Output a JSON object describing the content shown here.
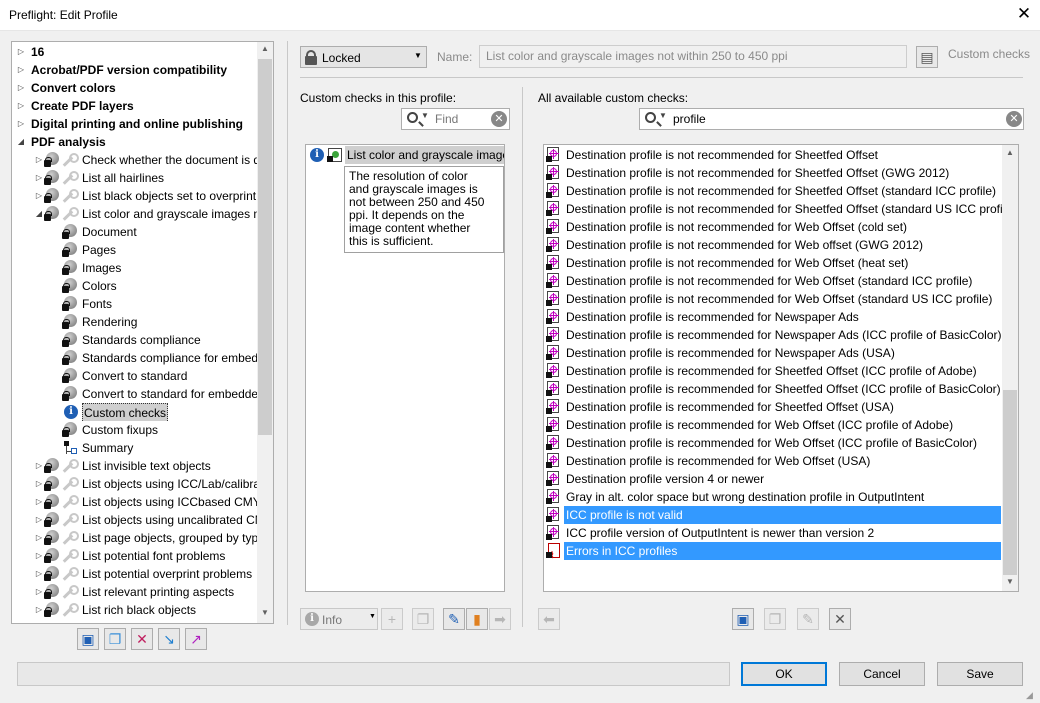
{
  "window": {
    "title": "Preflight: Edit Profile",
    "close_glyph": "✕"
  },
  "tree": {
    "items": [
      {
        "label": "16",
        "bold": true,
        "indent": 0,
        "arrow": "▷",
        "icon": "none"
      },
      {
        "label": "Acrobat/PDF version compatibility",
        "bold": true,
        "indent": 0,
        "arrow": "▷",
        "icon": "none"
      },
      {
        "label": "Convert colors",
        "bold": true,
        "indent": 0,
        "arrow": "▷",
        "icon": "none"
      },
      {
        "label": "Create PDF layers",
        "bold": true,
        "indent": 0,
        "arrow": "▷",
        "icon": "none"
      },
      {
        "label": "Digital printing and online publishing",
        "bold": true,
        "indent": 0,
        "arrow": "▷",
        "icon": "none"
      },
      {
        "label": "PDF analysis",
        "bold": true,
        "indent": 0,
        "arrow": "◢",
        "icon": "none"
      },
      {
        "label": "Check whether the document is d",
        "bold": false,
        "indent": 1,
        "arrow": "▷",
        "icon": "lock-wrench"
      },
      {
        "label": "List all hairlines",
        "bold": false,
        "indent": 1,
        "arrow": "▷",
        "icon": "lock-wrench"
      },
      {
        "label": "List black objects set to overprint",
        "bold": false,
        "indent": 1,
        "arrow": "▷",
        "icon": "lock-wrench"
      },
      {
        "label": "List color and grayscale images no",
        "bold": false,
        "indent": 1,
        "arrow": "◢",
        "icon": "lock-wrench"
      },
      {
        "label": "Document",
        "bold": false,
        "indent": 2,
        "arrow": "",
        "icon": "lock"
      },
      {
        "label": "Pages",
        "bold": false,
        "indent": 2,
        "arrow": "",
        "icon": "lock"
      },
      {
        "label": "Images",
        "bold": false,
        "indent": 2,
        "arrow": "",
        "icon": "lock"
      },
      {
        "label": "Colors",
        "bold": false,
        "indent": 2,
        "arrow": "",
        "icon": "lock"
      },
      {
        "label": "Fonts",
        "bold": false,
        "indent": 2,
        "arrow": "",
        "icon": "lock"
      },
      {
        "label": "Rendering",
        "bold": false,
        "indent": 2,
        "arrow": "",
        "icon": "lock"
      },
      {
        "label": "Standards compliance",
        "bold": false,
        "indent": 2,
        "arrow": "",
        "icon": "lock"
      },
      {
        "label": "Standards compliance for embedc",
        "bold": false,
        "indent": 2,
        "arrow": "",
        "icon": "lock"
      },
      {
        "label": "Convert to standard",
        "bold": false,
        "indent": 2,
        "arrow": "",
        "icon": "lock"
      },
      {
        "label": "Convert to standard for embedde",
        "bold": false,
        "indent": 2,
        "arrow": "",
        "icon": "lock"
      },
      {
        "label": "Custom checks",
        "bold": false,
        "indent": 2,
        "arrow": "",
        "icon": "info",
        "selected": true
      },
      {
        "label": "Custom fixups",
        "bold": false,
        "indent": 2,
        "arrow": "",
        "icon": "lock"
      },
      {
        "label": "Summary",
        "bold": false,
        "indent": 2,
        "arrow": "",
        "icon": "summary"
      },
      {
        "label": "List invisible text objects",
        "bold": false,
        "indent": 1,
        "arrow": "▷",
        "icon": "lock-wrench"
      },
      {
        "label": "List objects using ICC/Lab/calibrat",
        "bold": false,
        "indent": 1,
        "arrow": "▷",
        "icon": "lock-wrench"
      },
      {
        "label": "List objects using ICCbased CMYK",
        "bold": false,
        "indent": 1,
        "arrow": "▷",
        "icon": "lock-wrench"
      },
      {
        "label": "List objects using uncalibrated CM",
        "bold": false,
        "indent": 1,
        "arrow": "▷",
        "icon": "lock-wrench"
      },
      {
        "label": "List page objects, grouped by type",
        "bold": false,
        "indent": 1,
        "arrow": "▷",
        "icon": "lock-wrench"
      },
      {
        "label": "List potential font problems",
        "bold": false,
        "indent": 1,
        "arrow": "▷",
        "icon": "lock-wrench"
      },
      {
        "label": "List potential overprint problems",
        "bold": false,
        "indent": 1,
        "arrow": "▷",
        "icon": "lock-wrench"
      },
      {
        "label": "List relevant printing aspects",
        "bold": false,
        "indent": 1,
        "arrow": "▷",
        "icon": "lock-wrench"
      },
      {
        "label": "List rich black objects",
        "bold": false,
        "indent": 1,
        "arrow": "▷",
        "icon": "lock-wrench"
      }
    ]
  },
  "tree_toolbar": [
    "new-icon",
    "duplicate-icon",
    "delete-icon",
    "import-icon",
    "export-icon"
  ],
  "header": {
    "locked_label": "Locked",
    "name_label": "Name:",
    "name_value": "List color and grayscale images not within 250 to 450 ppi",
    "custom_checks_label": "Custom checks"
  },
  "profile_checks": {
    "heading": "Custom checks in this profile:",
    "search_placeholder": "Find",
    "items": [
      {
        "label": "List color and grayscale images"
      }
    ],
    "tooltip": [
      "The resolution of color",
      "and grayscale images is",
      "not between 250 and 450",
      "ppi. It depends on the",
      "image content whether",
      "this is sufficient."
    ],
    "info_dropdown_label": "Info"
  },
  "available_checks": {
    "heading": "All available custom checks:",
    "search_value": "profile",
    "items": [
      {
        "label": "Destination profile is not recommended for Sheetfed Offset",
        "icon": "check"
      },
      {
        "label": "Destination profile is not recommended for Sheetfed Offset (GWG 2012)",
        "icon": "check"
      },
      {
        "label": "Destination profile is not recommended for Sheetfed Offset (standard ICC profile)",
        "icon": "check"
      },
      {
        "label": "Destination profile is not recommended for Sheetfed Offset (standard US ICC profile)",
        "icon": "check"
      },
      {
        "label": "Destination profile is not recommended for Web Offset (cold set)",
        "icon": "check"
      },
      {
        "label": "Destination profile is not recommended for Web offset (GWG 2012)",
        "icon": "check"
      },
      {
        "label": "Destination profile is not recommended for Web Offset (heat set)",
        "icon": "check"
      },
      {
        "label": "Destination profile is not recommended for Web Offset (standard ICC profile)",
        "icon": "check"
      },
      {
        "label": "Destination profile is not recommended for Web Offset (standard US ICC profile)",
        "icon": "check"
      },
      {
        "label": "Destination profile is recommended for Newspaper Ads",
        "icon": "check"
      },
      {
        "label": "Destination profile is recommended for Newspaper Ads (ICC profile of BasicColor)",
        "icon": "check"
      },
      {
        "label": "Destination profile is recommended for Newspaper Ads (USA)",
        "icon": "check"
      },
      {
        "label": "Destination profile is recommended for Sheetfed Offset (ICC profile of Adobe)",
        "icon": "check"
      },
      {
        "label": "Destination profile is recommended for Sheetfed Offset (ICC profile of BasicColor)",
        "icon": "check"
      },
      {
        "label": "Destination profile is recommended for Sheetfed Offset (USA)",
        "icon": "check"
      },
      {
        "label": "Destination profile is recommended for Web Offset (ICC profile of Adobe)",
        "icon": "check"
      },
      {
        "label": "Destination profile is recommended for Web Offset (ICC profile of BasicColor)",
        "icon": "check"
      },
      {
        "label": "Destination profile is recommended for Web Offset (USA)",
        "icon": "check"
      },
      {
        "label": "Destination profile version 4 or newer",
        "icon": "check"
      },
      {
        "label": "Gray in alt. color space but wrong destination profile in OutputIntent",
        "icon": "check"
      },
      {
        "label": "ICC profile is not valid",
        "icon": "check",
        "selected": true
      },
      {
        "label": "ICC profile version of OutputIntent is newer than version 2",
        "icon": "check"
      },
      {
        "label": "Errors in ICC profiles",
        "icon": "pdf",
        "selected": true
      }
    ]
  },
  "footer": {
    "ok_label": "OK",
    "cancel_label": "Cancel",
    "save_label": "Save"
  },
  "colors": {
    "selection": "#3399ff",
    "default_button_border": "#0078d7"
  }
}
